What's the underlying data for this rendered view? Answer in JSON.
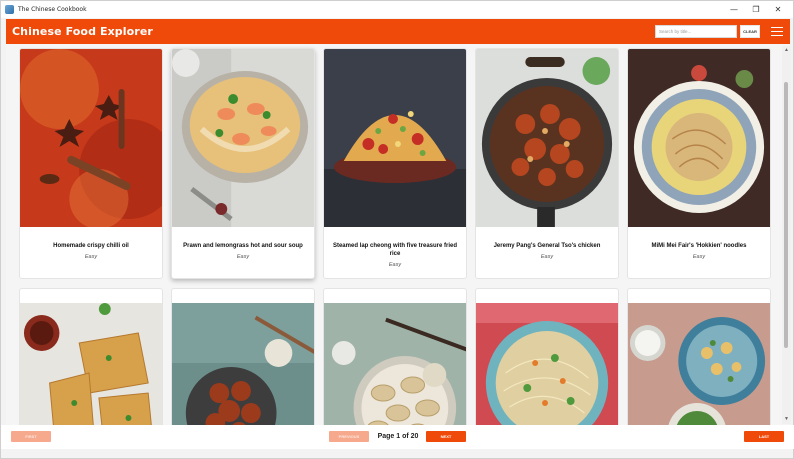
{
  "window": {
    "title": "The Chinese Cookbook",
    "minimize": "—",
    "maximize": "❐",
    "close": "✕"
  },
  "header": {
    "app_title": "Chinese Food Explorer",
    "search_placeholder": "Search by title...",
    "search_value": "",
    "clear_label": "CLEAR",
    "accent_color": "#f04a0a"
  },
  "recipes": [
    {
      "name": "Homemade crispy chilli oil",
      "difficulty": "Easy",
      "image": "chilli-oil-photo"
    },
    {
      "name": "Prawn and lemongrass hot and sour soup",
      "difficulty": "Easy",
      "image": "prawn-soup-photo"
    },
    {
      "name": "Steamed lap cheong with five treasure fried rice",
      "difficulty": "Easy",
      "image": "fried-rice-photo"
    },
    {
      "name": "Jeremy Pang's General Tso's chicken",
      "difficulty": "Easy",
      "image": "general-tso-chicken-photo"
    },
    {
      "name": "MiMi Mei Fair's 'Hokkien' noodles",
      "difficulty": "Easy",
      "image": "hokkien-noodles-photo"
    },
    {
      "name": "",
      "difficulty": "",
      "image": "scallion-pancake-photo"
    },
    {
      "name": "",
      "difficulty": "",
      "image": "crispy-chicken-photo"
    },
    {
      "name": "",
      "difficulty": "",
      "image": "dumplings-photo"
    },
    {
      "name": "",
      "difficulty": "",
      "image": "noodle-salad-photo"
    },
    {
      "name": "",
      "difficulty": "",
      "image": "kung-pao-photo"
    }
  ],
  "pagination": {
    "first_label": "FIRST",
    "previous_label": "PREVIOUS",
    "page_label": "Page 1 of 20",
    "next_label": "NEXT",
    "last_label": "LAST"
  }
}
